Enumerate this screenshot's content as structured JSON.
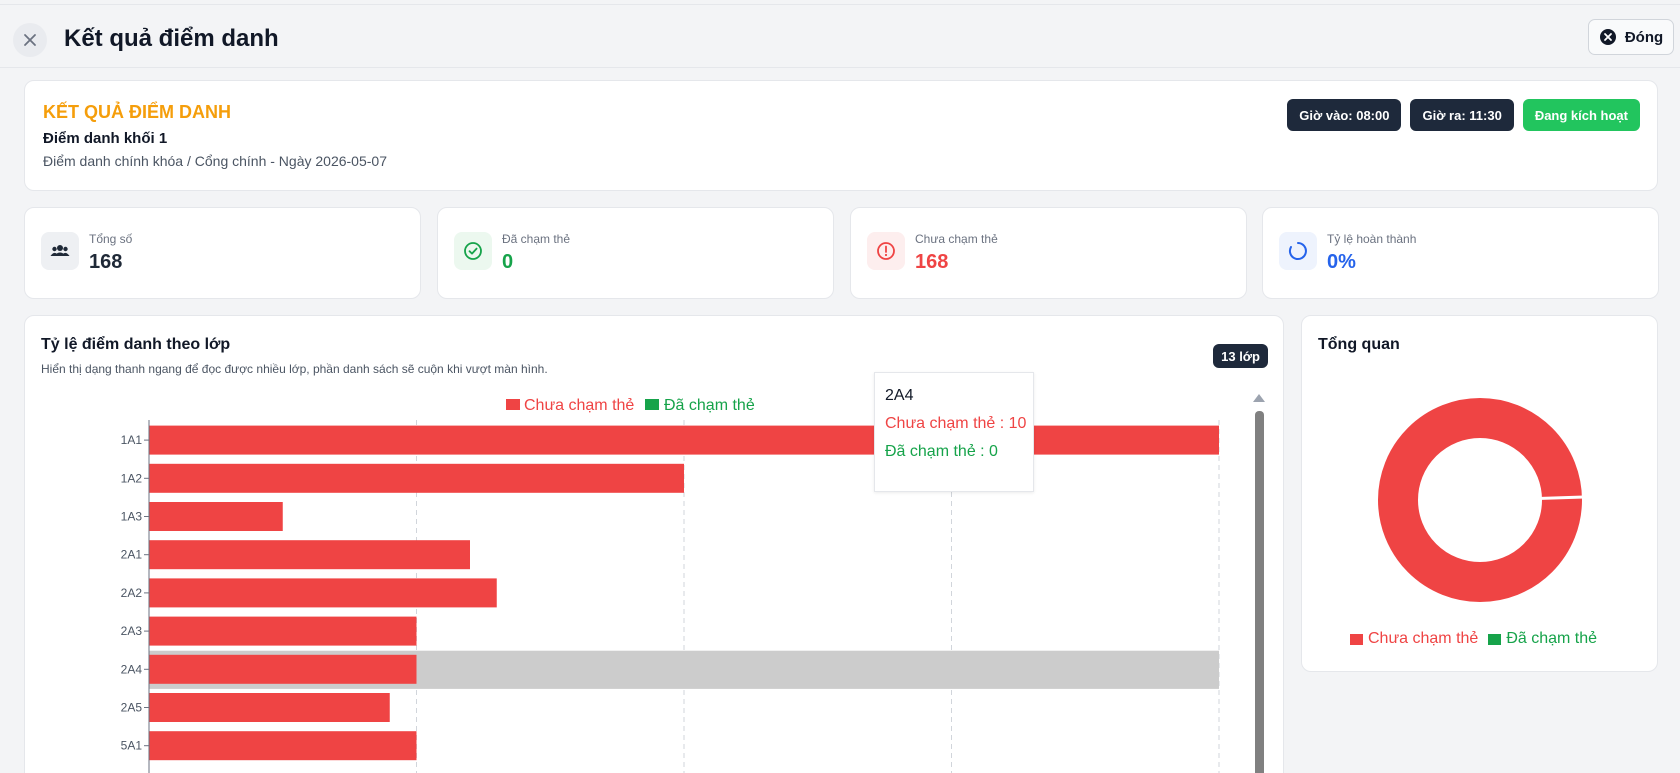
{
  "header": {
    "title": "Kết quả điểm danh",
    "close_label": "Đóng"
  },
  "summary": {
    "kicker": "KẾT QUẢ ĐIỂM DANH",
    "title": "Điểm danh khối 1",
    "subtitle": "Điểm danh chính khóa / Cổng chính - Ngày 2026-05-07",
    "tags": {
      "checkin": "Giờ vào: 08:00",
      "checkout": "Giờ ra: 11:30",
      "status": "Đang kích hoạt"
    }
  },
  "stats": [
    {
      "label": "Tổng số",
      "value": "168",
      "icon": "users-icon",
      "color": "#1f2937"
    },
    {
      "label": "Đã chạm thẻ",
      "value": "0",
      "icon": "check-circle-icon",
      "color": "#16a34a"
    },
    {
      "label": "Chưa chạm thẻ",
      "value": "168",
      "icon": "alert-circle-icon",
      "color": "#ef4444"
    },
    {
      "label": "Tỷ lệ hoàn thành",
      "value": "0%",
      "icon": "progress-ring-icon",
      "color": "#2563eb"
    }
  ],
  "class_chart": {
    "title": "Tỷ lệ điểm danh theo lớp",
    "description": "Hiển thị dạng thanh ngang để đọc được nhiều lớp, phần danh sách sẽ cuộn khi vượt màn hình.",
    "count_badge": "13 lớp"
  },
  "chart_data": {
    "type": "bar",
    "orientation": "horizontal",
    "stacked": true,
    "categories": [
      "1A1",
      "1A2",
      "1A3",
      "2A1",
      "2A2",
      "2A3",
      "2A4",
      "2A5",
      "5A1"
    ],
    "series": [
      {
        "name": "Chưa chạm thẻ",
        "color": "#ef4444",
        "values": [
          40,
          20,
          5,
          12,
          13,
          10,
          10,
          9,
          10
        ]
      },
      {
        "name": "Đã chạm thẻ",
        "color": "#16a34a",
        "values": [
          0,
          0,
          0,
          0,
          0,
          0,
          0,
          0,
          0
        ]
      }
    ],
    "xlim": [
      0,
      40
    ],
    "grid": true,
    "legend": "top",
    "highlighted_category": "2A4"
  },
  "tooltip": {
    "title": "2A4",
    "not_tapped": "Chưa chạm thẻ : 10",
    "tapped": "Đã chạm thẻ : 0"
  },
  "overview": {
    "title": "Tổng quan",
    "legend": {
      "not_tapped": "Chưa chạm thẻ",
      "tapped": "Đã chạm thẻ"
    },
    "values": {
      "not_tapped": 168,
      "tapped": 0
    }
  }
}
